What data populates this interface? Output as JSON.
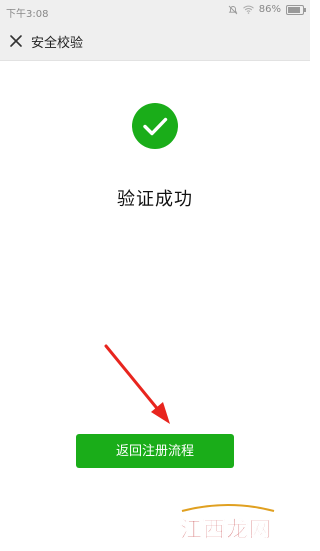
{
  "status_bar": {
    "time": "下午3:08",
    "battery": "86%",
    "battery_level": 0.86,
    "icons": [
      "alarm-off-icon",
      "wifi-icon",
      "battery-icon"
    ]
  },
  "nav": {
    "close_icon": "close-icon",
    "title": "安全校验"
  },
  "result": {
    "icon": "check-circle-icon",
    "title": "验证成功"
  },
  "actions": {
    "return_label": "返回注册流程"
  },
  "watermark": {
    "text": "江西龙网"
  },
  "colors": {
    "accent": "#1aad19",
    "annotation": "#e8251e",
    "nav_bg": "#efefef"
  }
}
